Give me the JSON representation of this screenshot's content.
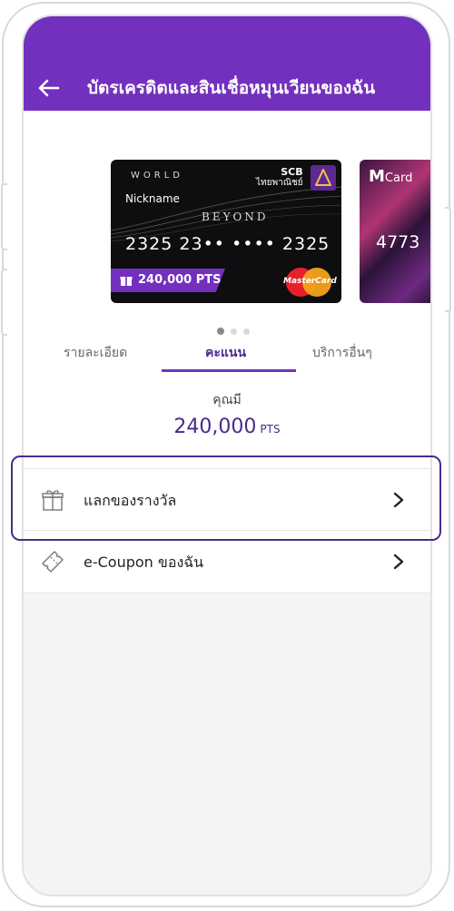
{
  "header": {
    "title": "บัตรเครดิตและสินเชื่อหมุนเวียนของฉัน"
  },
  "card": {
    "tier": "WORLD",
    "nickname": "Nickname",
    "product": "BEYOND",
    "number": "2325 23•• •••• 2325",
    "bank_name": "SCB",
    "bank_name_th": "ไทยพาณิชย์",
    "points_badge": "240,000 PTS",
    "network": "MasterCard"
  },
  "card2": {
    "brand": "M",
    "brand_suffix": "Card",
    "number": "4773"
  },
  "carousel": {
    "total": 3,
    "active": 1
  },
  "tabs": [
    {
      "label": "รายละเอียด"
    },
    {
      "label": "คะแนน",
      "active": true
    },
    {
      "label": "บริการอื่นๆ"
    }
  ],
  "points": {
    "label": "คุณมี",
    "value": "240,000",
    "unit": "PTS"
  },
  "menu": [
    {
      "label": "แลกของรางวัล",
      "icon": "gift-icon"
    },
    {
      "label": "e-Coupon ของฉัน",
      "icon": "coupon-icon"
    }
  ],
  "colors": {
    "primary": "#7330bf",
    "accent_text": "#4a2a8a"
  }
}
